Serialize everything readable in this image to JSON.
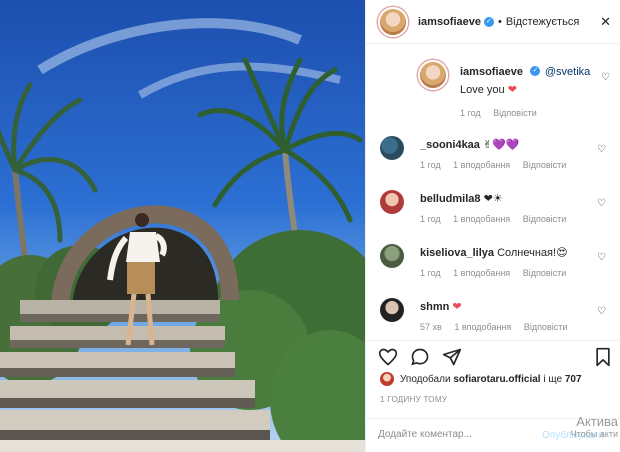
{
  "post": {
    "image_description_icon": "beach-photo",
    "author": "iamsofiaeve",
    "follow_status": "Відстежується"
  },
  "caption": {
    "username": "iamsofiaeve",
    "mention": "@svetika",
    "text": "Love you",
    "emoji": "❤",
    "time": "1 год",
    "reply_label": "Відповісти"
  },
  "comments": [
    {
      "username": "_sooni4kaa",
      "text": "✌💜💜",
      "time": "1 год",
      "likes": "1 вподобання",
      "reply": "Відповісти"
    },
    {
      "username": "belludmila8",
      "text": "❤☀",
      "time": "1 год",
      "likes": "1 вподобання",
      "reply": "Відповісти"
    },
    {
      "username": "kiseliova_lilya",
      "text": "Солнечная!😍",
      "time": "1 год",
      "likes": "1 вподобання",
      "reply": "Відповісти"
    },
    {
      "username": "shmn",
      "text": "❤",
      "time": "57 хв",
      "likes": "1 вподобання",
      "reply": "Відповісти"
    }
  ],
  "likes": {
    "prefix": "Уподобали",
    "user": "sofiarotaru.official",
    "suffix": "і ще",
    "count": "707"
  },
  "time_ago": "1 ГОДИНУ ТОМУ",
  "add_comment": {
    "placeholder": "Додайте коментар...",
    "publish": "Опублікувати"
  },
  "activation": {
    "line1": "Актива",
    "line2": "Чтобы акти"
  },
  "colors": {
    "accent": "#3897f0",
    "heart": "#ed4956",
    "muted": "#8e8e8e"
  }
}
